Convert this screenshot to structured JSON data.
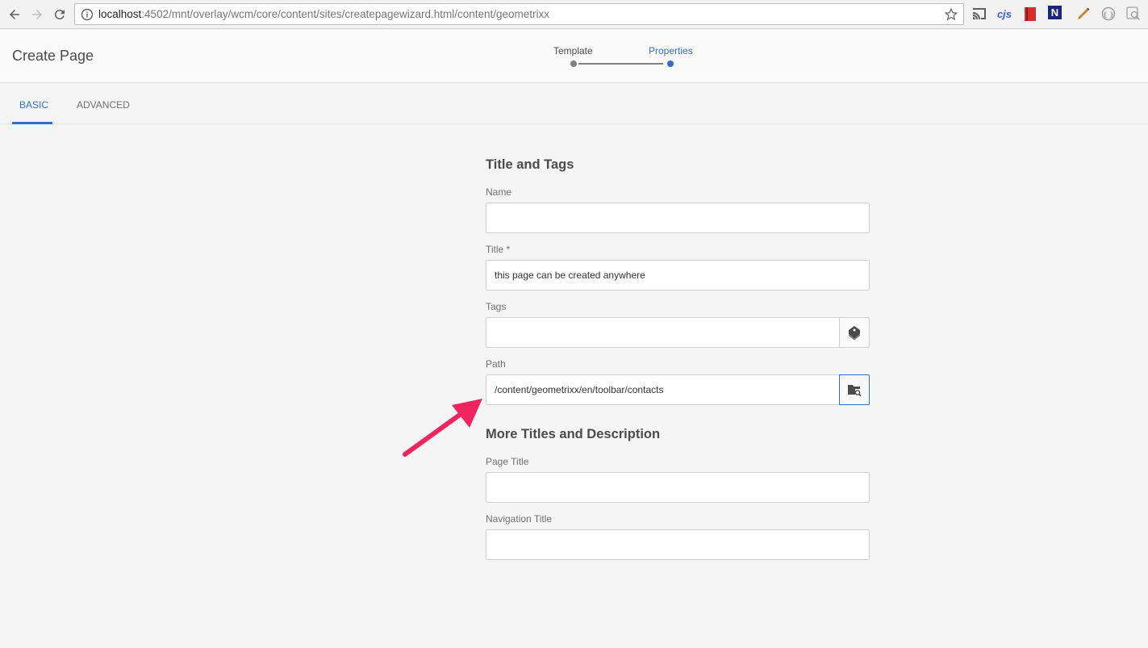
{
  "browser": {
    "url_host": "localhost",
    "url_path": ":4502/mnt/overlay/wcm/core/content/sites/createpagewizard.html/content/geometrixx",
    "extensions": [
      {
        "name": "cast-icon",
        "glyph": ""
      },
      {
        "name": "cjs-extension-icon",
        "glyph": "cjs"
      },
      {
        "name": "book-extension-icon",
        "glyph": ""
      },
      {
        "name": "n-extension-icon",
        "glyph": "N"
      },
      {
        "name": "pen-extension-icon",
        "glyph": ""
      },
      {
        "name": "circle-extension-icon",
        "glyph": ""
      },
      {
        "name": "magnifier-extension-icon",
        "glyph": ""
      }
    ]
  },
  "header": {
    "title": "Create Page",
    "steps": [
      {
        "label": "Template",
        "state": "done"
      },
      {
        "label": "Properties",
        "state": "current"
      }
    ]
  },
  "tabs": [
    {
      "label": "BASIC",
      "active": true
    },
    {
      "label": "ADVANCED",
      "active": false
    }
  ],
  "form": {
    "section1_title": "Title and Tags",
    "name_label": "Name",
    "name_value": "",
    "title_label": "Title *",
    "title_value": "this page can be created anywhere",
    "tags_label": "Tags",
    "tags_value": "",
    "path_label": "Path",
    "path_value": "/content/geometrixx/en/toolbar/contacts",
    "section2_title": "More Titles and Description",
    "page_title_label": "Page Title",
    "page_title_value": "",
    "nav_title_label": "Navigation Title",
    "nav_title_value": ""
  },
  "colors": {
    "accent": "#326ec8",
    "annotation_arrow": "#f0245f"
  }
}
